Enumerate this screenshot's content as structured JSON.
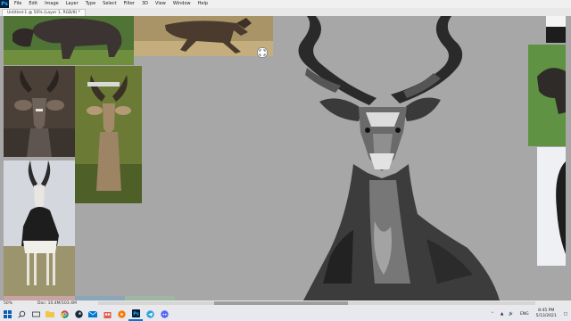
{
  "app": {
    "logo": "Ps",
    "name": "Adobe Photoshop"
  },
  "menu": [
    "File",
    "Edit",
    "Image",
    "Layer",
    "Type",
    "Select",
    "Filter",
    "3D",
    "View",
    "Window",
    "Help"
  ],
  "document_tab": {
    "title": "Untitled-1 @ 50% (Layer 1, RGB/8) *"
  },
  "status": {
    "zoom": "50%",
    "doc": "Doc: 10.4M/103.4M"
  },
  "taskbar": {
    "time": "8:45 PM",
    "date": "5/13/2021",
    "lang": "ENG",
    "apps": [
      "windows-logo",
      "search-icon",
      "file-explorer-icon",
      "chrome-icon",
      "steam-icon",
      "mail-icon",
      "store-icon",
      "media-icon",
      "photoshop-icon",
      "telegram-icon",
      "discord-icon"
    ]
  },
  "colors": {
    "canvas": "#a7a7a7",
    "ps_blue": "#31a8ff",
    "ps_dark": "#001e36",
    "taskbar": "#e7e9ee"
  }
}
